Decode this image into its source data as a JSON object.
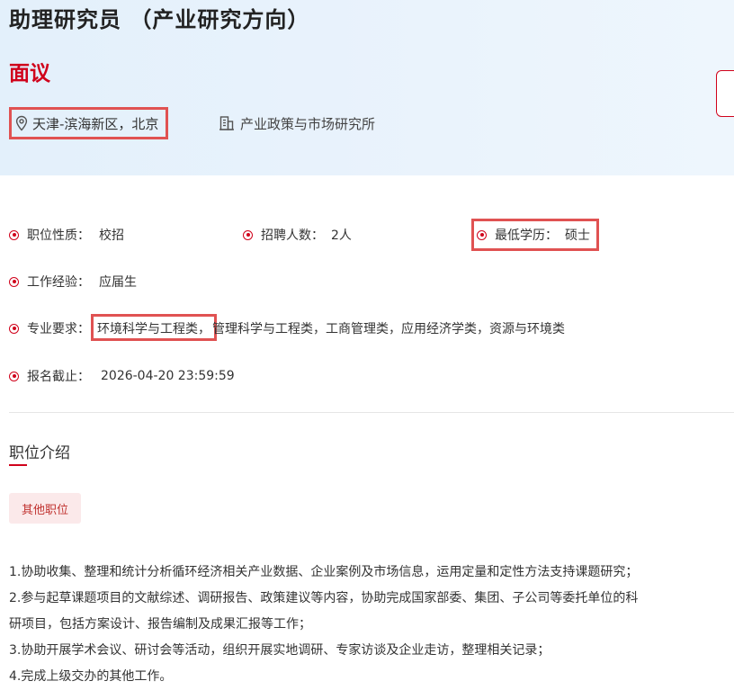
{
  "job": {
    "title": "助理研究员 （产业研究方向）",
    "salary": "面议",
    "location": "天津-滨海新区，北京",
    "organization": "产业政策与市场研究所"
  },
  "details": {
    "nature": {
      "label": "职位性质：",
      "value": "校招"
    },
    "headcount": {
      "label": "招聘人数：",
      "value": "2人"
    },
    "education": {
      "label": "最低学历：",
      "value": "硕士"
    },
    "experience": {
      "label": "工作经验：",
      "value": "应届生"
    },
    "major": {
      "label": "专业要求：",
      "highlighted": "环境科学与工程类，",
      "rest": "管理科学与工程类，工商管理类，应用经济学类，资源与环境类"
    },
    "deadline": {
      "label": "报名截止：",
      "value": "2026-04-20 23:59:59"
    }
  },
  "intro": {
    "section_title": "职位介绍",
    "tag": "其他职位",
    "lines": [
      "1.协助收集、整理和统计分析循环经济相关产业数据、企业案例及市场信息，运用定量和定性方法支持课题研究；",
      "2.参与起草课题项目的文献综述、调研报告、政策建议等内容，协助完成国家部委、集团、子公司等委托单位的科",
      "研项目，包括方案设计、报告编制及成果汇报等工作；",
      "3.协助开展学术会议、研讨会等活动，组织开展实地调研、专家访谈及企业走访，整理相关记录；",
      "4.完成上级交办的其他工作。"
    ]
  },
  "icons": {
    "location": "map-pin-icon",
    "organization": "building-icon",
    "bullet": "radio-dot-icon"
  },
  "colors": {
    "accent": "#d0021b",
    "highlight_box": "#e05252",
    "header_bg": "#e6f1fb",
    "tag_bg": "#fbe9ea"
  }
}
